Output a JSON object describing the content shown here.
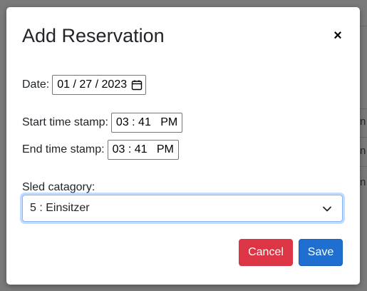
{
  "modal": {
    "title": "Add Reservation",
    "close_label": "×"
  },
  "date": {
    "label": "Date:",
    "value": "01 / 27 / 2023"
  },
  "start_time": {
    "label": "Start time stamp:",
    "value": "03 : 41   PM"
  },
  "end_time": {
    "label": "End time stamp:",
    "value": "03 : 41   PM"
  },
  "sled_category": {
    "label": "Sled catagory:",
    "selected": "5 : Einsitzer"
  },
  "buttons": {
    "cancel": "Cancel",
    "save": "Save"
  },
  "background": {
    "table_cells": [
      "n",
      "n",
      "n"
    ]
  },
  "colors": {
    "cancel": "#dc3545",
    "save": "#1e6fd0",
    "focus_border": "#86b7fe"
  }
}
